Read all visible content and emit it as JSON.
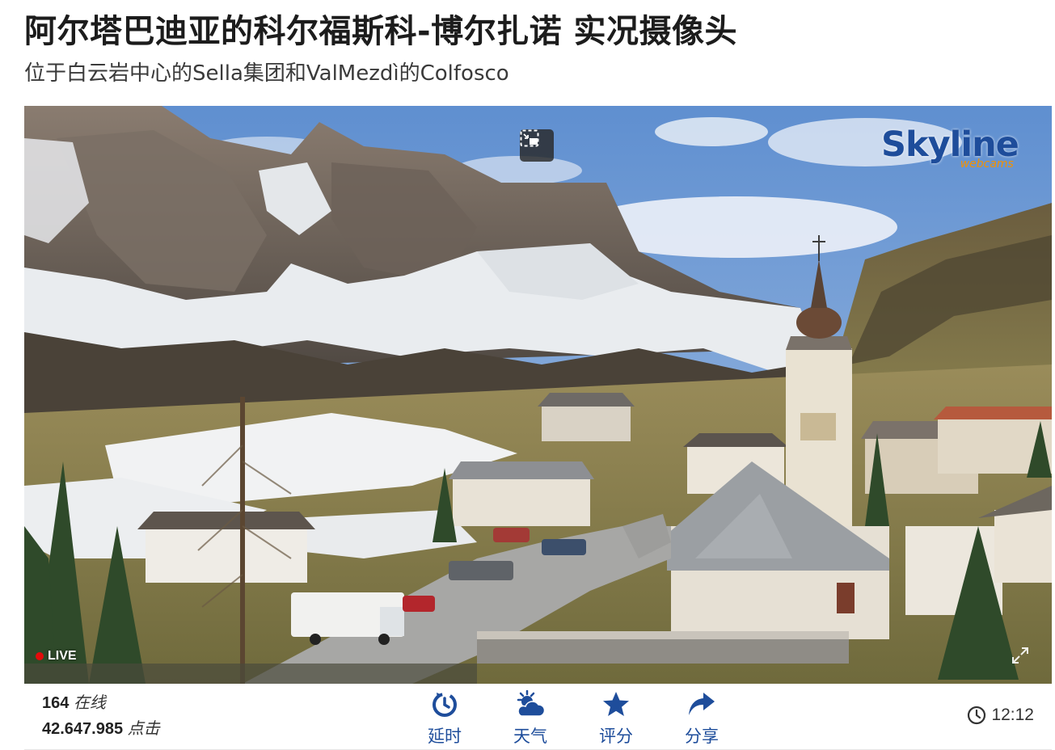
{
  "page": {
    "title": "阿尔塔巴迪亚的科尔福斯科-博尔扎诺 实况摄像头",
    "subtitle": "位于白云岩中心的Sella集团和ValMezdì的Colfosco"
  },
  "player": {
    "logo_main": "Skyline",
    "logo_sub": "webcams",
    "live_label": "LIVE",
    "pip_icon": "picture-in-picture-icon",
    "fullscreen_icon": "fullscreen-icon"
  },
  "stats": {
    "online_count": "164",
    "online_label": "在线",
    "clicks_count": "42.647.985",
    "clicks_label": "点击"
  },
  "actions": [
    {
      "label": "延时",
      "icon": "timelapse-icon"
    },
    {
      "label": "天气",
      "icon": "weather-icon"
    },
    {
      "label": "评分",
      "icon": "star-icon"
    },
    {
      "label": "分享",
      "icon": "share-icon"
    }
  ],
  "clock": {
    "time": "12:12",
    "icon": "clock-icon"
  },
  "colors": {
    "brand_blue": "#1e4d9b",
    "brand_orange": "#f39200",
    "live_red": "#e30b0b"
  }
}
